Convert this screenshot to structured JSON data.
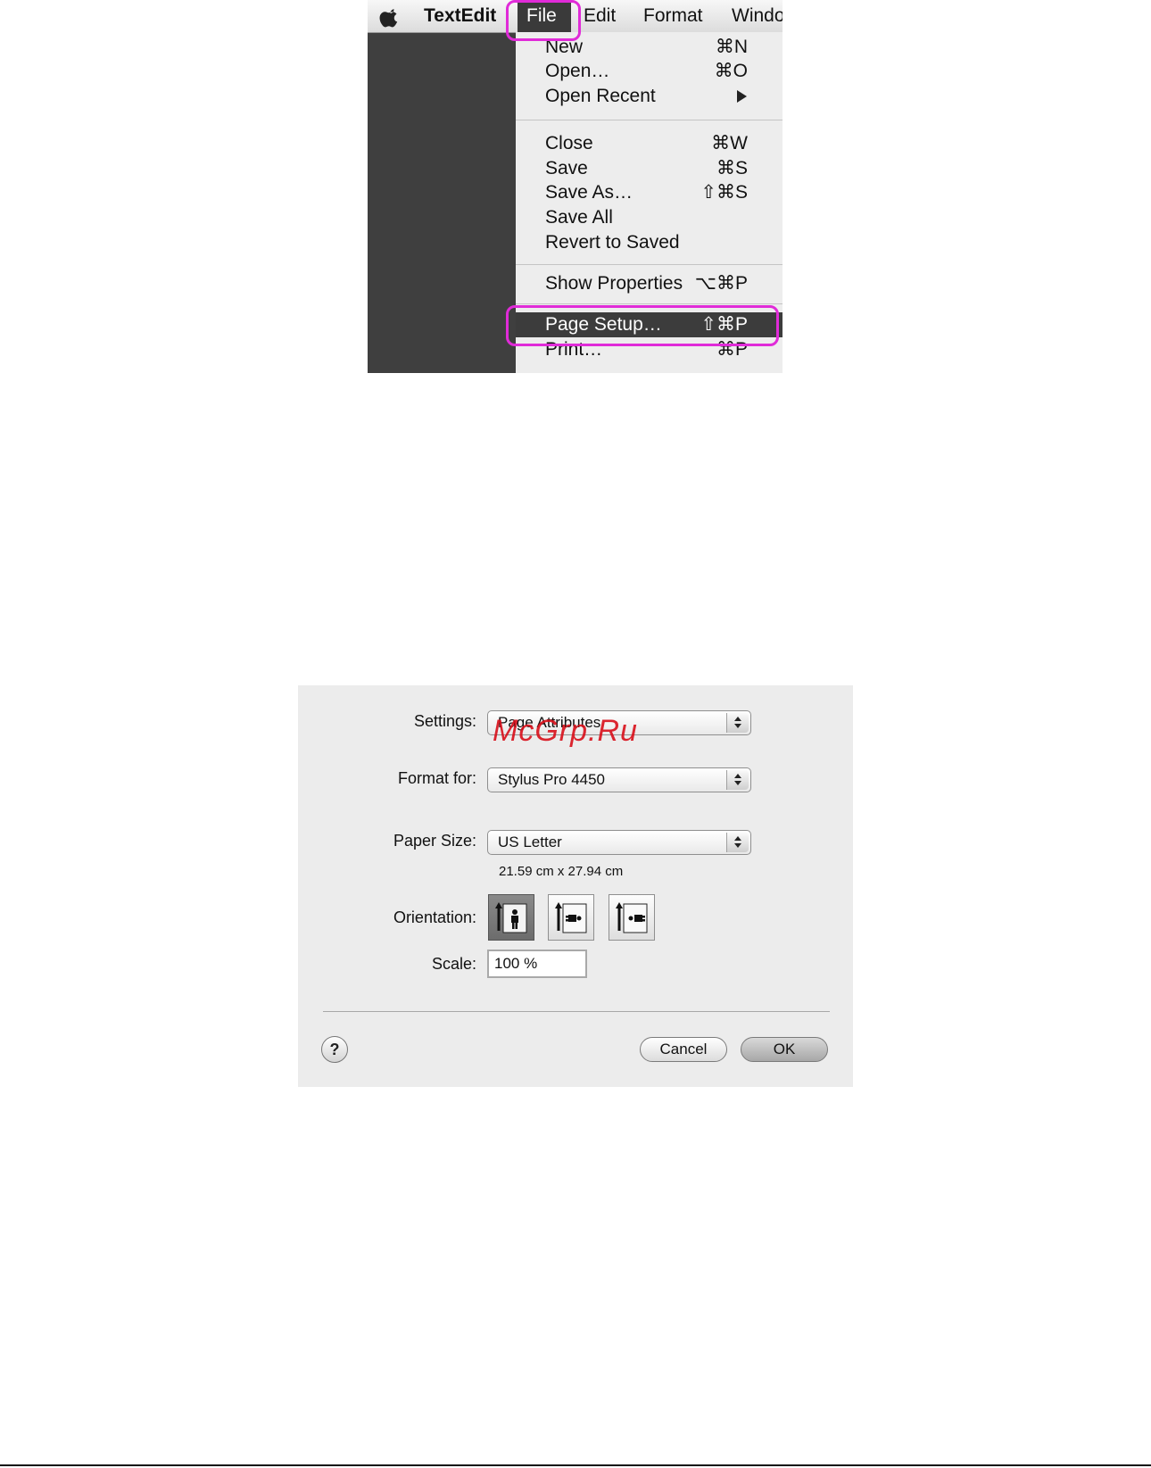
{
  "menubar": {
    "app_name": "TextEdit",
    "items": [
      "File",
      "Edit",
      "Format",
      "Windo"
    ]
  },
  "file_menu": {
    "items": [
      {
        "label": "New",
        "shortcut": "⌘N"
      },
      {
        "label": "Open…",
        "shortcut": "⌘O"
      },
      {
        "label": "Open Recent",
        "submenu": true
      },
      {
        "label": "Close",
        "shortcut": "⌘W"
      },
      {
        "label": "Save",
        "shortcut": "⌘S"
      },
      {
        "label": "Save As…",
        "shortcut": "⇧⌘S"
      },
      {
        "label": "Save All"
      },
      {
        "label": "Revert to Saved"
      },
      {
        "label": "Show Properties",
        "shortcut": "⌥⌘P"
      },
      {
        "label": "Page Setup…",
        "shortcut": "⇧⌘P",
        "highlighted": true
      },
      {
        "label": "Print…",
        "shortcut": "⌘P"
      }
    ]
  },
  "page_setup": {
    "settings_label": "Settings:",
    "settings_value": "Page Attributes",
    "format_for_label": "Format for:",
    "format_for_value": "Stylus Pro 4450",
    "paper_size_label": "Paper Size:",
    "paper_size_value": "US Letter",
    "paper_dimensions": "21.59 cm x 27.94 cm",
    "orientation_label": "Orientation:",
    "orientation_options": [
      "portrait",
      "landscape-left",
      "landscape-right"
    ],
    "orientation_selected": "portrait",
    "scale_label": "Scale:",
    "scale_value": "100 %",
    "help_symbol": "?",
    "cancel_label": "Cancel",
    "ok_label": "OK"
  },
  "watermark": "McGrp.Ru",
  "colors": {
    "callout": "#e02bd8",
    "menu_highlight": "#3c3c3c",
    "watermark": "#d90f1a"
  }
}
